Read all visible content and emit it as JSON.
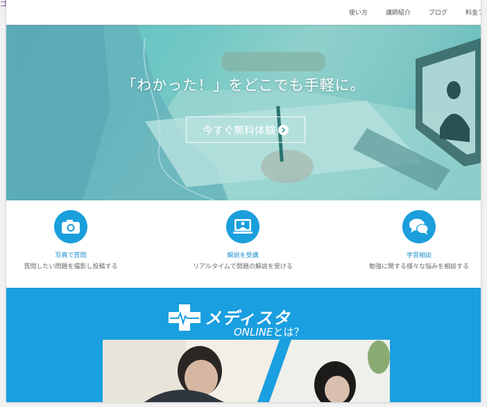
{
  "top_mark": "ゴ",
  "nav": {
    "items": [
      "使い方",
      "講師紹介",
      "ブログ",
      "料金プ"
    ]
  },
  "hero": {
    "title": "「わかった！」をどこでも手軽に。",
    "cta_label": "今すぐ無料体験"
  },
  "features": [
    {
      "icon": "camera-icon",
      "title": "写真で質問",
      "desc": "質問したい問題を撮影し投稿する"
    },
    {
      "icon": "video-lecture-icon",
      "title": "解説を受講",
      "desc": "リアルタイムで問題の解説を受ける"
    },
    {
      "icon": "chat-bubbles-icon",
      "title": "学習相談",
      "desc": "勉強に関する様々な悩みを相談する"
    }
  ],
  "brand": {
    "logo_name": "メディスタ",
    "logo_sub_online": "ONLINE",
    "logo_sub_rest": "とは？"
  },
  "colors": {
    "accent_blue": "#1a9fe0",
    "feature_icon_bg": "#1a9fdc",
    "hero_tint": "#2aaaaa"
  }
}
